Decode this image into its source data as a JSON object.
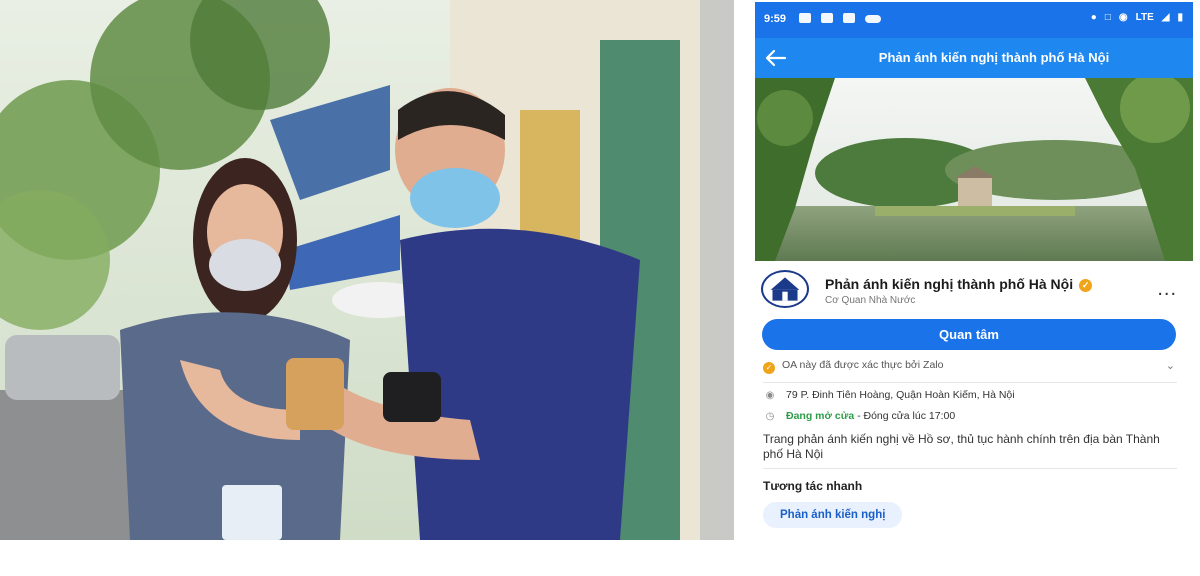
{
  "photo": {
    "subject": "two-people-with-smartphones"
  },
  "phone": {
    "status_bar": {
      "time": "9:59",
      "network": "LTE"
    },
    "header": {
      "title": "Phản ánh kiến nghị thành phố Hà Nội"
    },
    "profile": {
      "name": "Phản ánh kiến nghị thành phố Hà Nội",
      "category": "Cơ Quan Nhà Nước",
      "more": "..."
    },
    "follow_button": "Quan tâm",
    "verification": "OA này đã được xác thực bởi Zalo",
    "address": "79 P. Đinh Tiên Hoàng, Quận Hoàn Kiếm, Hà Nội",
    "hours": {
      "status": "Đang mở cửa",
      "closing": " - Đóng cửa lúc 17:00"
    },
    "description": "Trang phản ánh kiến nghị về Hồ sơ, thủ tục hành chính trên địa bàn Thành phố Hà Nội",
    "quick_actions": {
      "title": "Tương tác nhanh",
      "chip": "Phản ánh kiến nghị"
    },
    "colors": {
      "primary": "#1a73e8",
      "verified": "#f0a419",
      "open": "#2e9d4a"
    }
  }
}
